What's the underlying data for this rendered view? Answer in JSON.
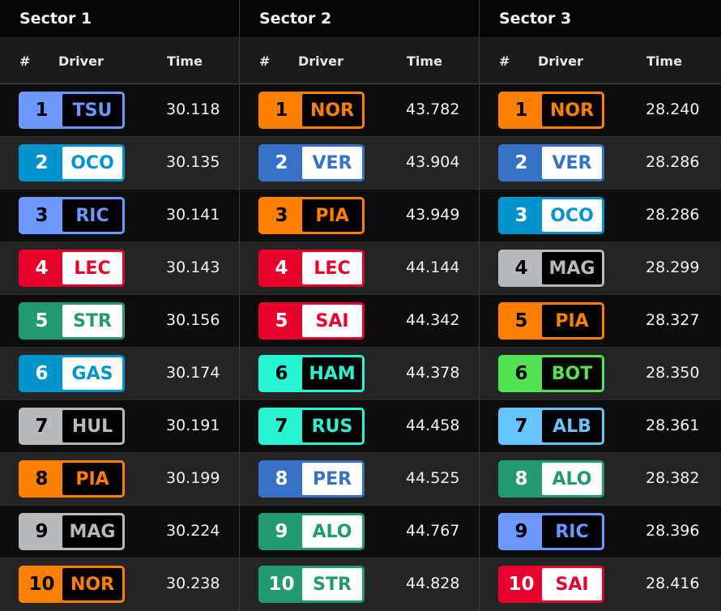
{
  "headers": {
    "num": "#",
    "driver": "Driver",
    "time": "Time"
  },
  "teams": {
    "rb": {
      "color": "#6c98ff",
      "inner": "#000000",
      "text": "#6c98ff",
      "num": "#000000"
    },
    "alpine": {
      "color": "#0093cc",
      "inner": "#ffffff",
      "text": "#0093cc",
      "num": "#ffffff"
    },
    "ferrari": {
      "color": "#e8002d",
      "inner": "#ffffff",
      "text": "#e8002d",
      "num": "#ffffff"
    },
    "aston": {
      "color": "#229971",
      "inner": "#ffffff",
      "text": "#229971",
      "num": "#ffffff"
    },
    "haas": {
      "color": "#b6babd",
      "inner": "#000000",
      "text": "#b6babd",
      "num": "#000000"
    },
    "mclaren": {
      "color": "#ff8000",
      "inner": "#000000",
      "text": "#ff8000",
      "num": "#000000"
    },
    "redbull": {
      "color": "#3671c6",
      "inner": "#ffffff",
      "text": "#3671c6",
      "num": "#ffffff"
    },
    "mercedes": {
      "color": "#27f4d2",
      "inner": "#000000",
      "text": "#27f4d2",
      "num": "#000000"
    },
    "sauber": {
      "color": "#52e252",
      "inner": "#000000",
      "text": "#52e252",
      "num": "#000000"
    },
    "williams": {
      "color": "#64c4ff",
      "inner": "#000000",
      "text": "#64c4ff",
      "num": "#000000"
    }
  },
  "sectors": [
    {
      "title": "Sector 1",
      "rows": [
        {
          "pos": "1",
          "code": "TSU",
          "team": "rb",
          "time": "30.118"
        },
        {
          "pos": "2",
          "code": "OCO",
          "team": "alpine",
          "time": "30.135"
        },
        {
          "pos": "3",
          "code": "RIC",
          "team": "rb",
          "time": "30.141"
        },
        {
          "pos": "4",
          "code": "LEC",
          "team": "ferrari",
          "time": "30.143"
        },
        {
          "pos": "5",
          "code": "STR",
          "team": "aston",
          "time": "30.156"
        },
        {
          "pos": "6",
          "code": "GAS",
          "team": "alpine",
          "time": "30.174"
        },
        {
          "pos": "7",
          "code": "HUL",
          "team": "haas",
          "time": "30.191"
        },
        {
          "pos": "8",
          "code": "PIA",
          "team": "mclaren",
          "time": "30.199"
        },
        {
          "pos": "9",
          "code": "MAG",
          "team": "haas",
          "time": "30.224"
        },
        {
          "pos": "10",
          "code": "NOR",
          "team": "mclaren",
          "time": "30.238"
        }
      ]
    },
    {
      "title": "Sector 2",
      "rows": [
        {
          "pos": "1",
          "code": "NOR",
          "team": "mclaren",
          "time": "43.782"
        },
        {
          "pos": "2",
          "code": "VER",
          "team": "redbull",
          "time": "43.904"
        },
        {
          "pos": "3",
          "code": "PIA",
          "team": "mclaren",
          "time": "43.949"
        },
        {
          "pos": "4",
          "code": "LEC",
          "team": "ferrari",
          "time": "44.144"
        },
        {
          "pos": "5",
          "code": "SAI",
          "team": "ferrari",
          "time": "44.342"
        },
        {
          "pos": "6",
          "code": "HAM",
          "team": "mercedes",
          "time": "44.378"
        },
        {
          "pos": "7",
          "code": "RUS",
          "team": "mercedes",
          "time": "44.458"
        },
        {
          "pos": "8",
          "code": "PER",
          "team": "redbull",
          "time": "44.525"
        },
        {
          "pos": "9",
          "code": "ALO",
          "team": "aston",
          "time": "44.767"
        },
        {
          "pos": "10",
          "code": "STR",
          "team": "aston",
          "time": "44.828"
        }
      ]
    },
    {
      "title": "Sector 3",
      "rows": [
        {
          "pos": "1",
          "code": "NOR",
          "team": "mclaren",
          "time": "28.240"
        },
        {
          "pos": "2",
          "code": "VER",
          "team": "redbull",
          "time": "28.286"
        },
        {
          "pos": "3",
          "code": "OCO",
          "team": "alpine",
          "time": "28.286"
        },
        {
          "pos": "4",
          "code": "MAG",
          "team": "haas",
          "time": "28.299"
        },
        {
          "pos": "5",
          "code": "PIA",
          "team": "mclaren",
          "time": "28.327"
        },
        {
          "pos": "6",
          "code": "BOT",
          "team": "sauber",
          "time": "28.350"
        },
        {
          "pos": "7",
          "code": "ALB",
          "team": "williams",
          "time": "28.361"
        },
        {
          "pos": "8",
          "code": "ALO",
          "team": "aston",
          "time": "28.382"
        },
        {
          "pos": "9",
          "code": "RIC",
          "team": "rb",
          "time": "28.396"
        },
        {
          "pos": "10",
          "code": "SAI",
          "team": "ferrari",
          "time": "28.416"
        }
      ]
    }
  ]
}
